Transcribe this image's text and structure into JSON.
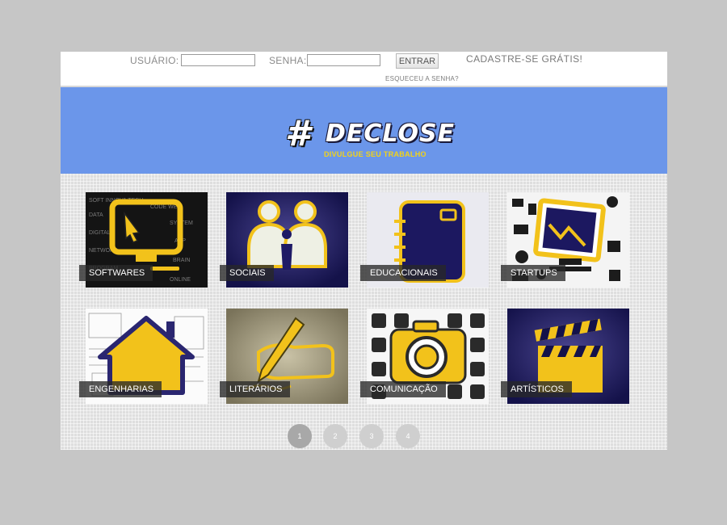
{
  "login": {
    "user_label": "USUÁRIO:",
    "user_value": "",
    "password_label": "SENHA:",
    "password_value": "",
    "enter_label": "ENTRAR",
    "signup_label": "CADASTRE-SE GRÁTIS!",
    "forgot_label": "ESQUECEU A SENHA?"
  },
  "brand": {
    "hash": "#",
    "name": "DECLOSE",
    "tagline": "DIVULGUE SEU TRABALHO",
    "accent": "#f2d318",
    "hero_color": "#6b96ea"
  },
  "categories": [
    {
      "label": "SOFTWARES",
      "icon": "computer-cursor-icon"
    },
    {
      "label": "SOCIAIS",
      "icon": "people-icon"
    },
    {
      "label": "EDUCACIONAIS",
      "icon": "notebook-icon"
    },
    {
      "label": "STARTUPS",
      "icon": "monitor-chart-icon"
    },
    {
      "label": "ENGENHARIAS",
      "icon": "house-icon"
    },
    {
      "label": "LITERÁRIOS",
      "icon": "hand-pen-icon"
    },
    {
      "label": "COMUNICAÇÃO",
      "icon": "camera-icon"
    },
    {
      "label": "ARTÍSTICOS",
      "icon": "clapperboard-icon"
    }
  ],
  "pagination": {
    "pages": [
      "1",
      "2",
      "3",
      "4"
    ],
    "active": "1"
  }
}
